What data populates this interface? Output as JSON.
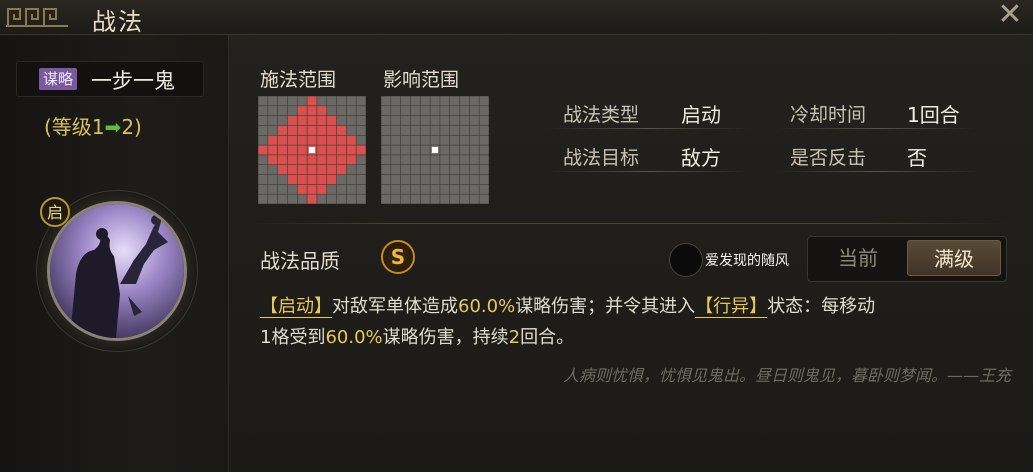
{
  "header": {
    "title": "战法",
    "close_icon": "close-icon"
  },
  "skill": {
    "tag": "谋略",
    "name": "一步一鬼",
    "level": {
      "open": "(等级",
      "from": "1",
      "arrow": "➡",
      "to": "2",
      "close": ")"
    },
    "trigger_badge": "启"
  },
  "ranges": {
    "cast_label": "施法范围",
    "effect_label": "影响范围",
    "cast_grid": {
      "size": 11,
      "shape": "diamond",
      "radius": 5
    },
    "effect_grid": {
      "size": 11,
      "shape": "center-only"
    },
    "colors": {
      "cell": "#6b6966",
      "range": "#d9504e",
      "center": "#ffffff"
    }
  },
  "info": {
    "type_label": "战法类型",
    "type_value": "启动",
    "target_label": "战法目标",
    "target_value": "敌方",
    "cooldown_label": "冷却时间",
    "cooldown_value": "1回合",
    "counter_label": "是否反击",
    "counter_value": "否"
  },
  "quality": {
    "label": "战法品质",
    "grade": "S"
  },
  "watermark": {
    "text": "爱发现的随风"
  },
  "toggle": {
    "current": "当前",
    "max": "满级",
    "selected": "满级"
  },
  "description": {
    "prefix": "【启动】",
    "part1": "对敌军单体造成",
    "pct1": "60.0%",
    "part2": "谋略伤害；并令其进入",
    "status": "【行异】",
    "part3": "状态：每移动",
    "line2_a": "1格受到",
    "pct2": "60.0%",
    "part4": "谋略伤害，持续",
    "turns": "2",
    "part5": "回合。"
  },
  "quote": "人病则忧惧，忧惧见鬼出。昼日则鬼见，暮卧则梦闻。——王充"
}
